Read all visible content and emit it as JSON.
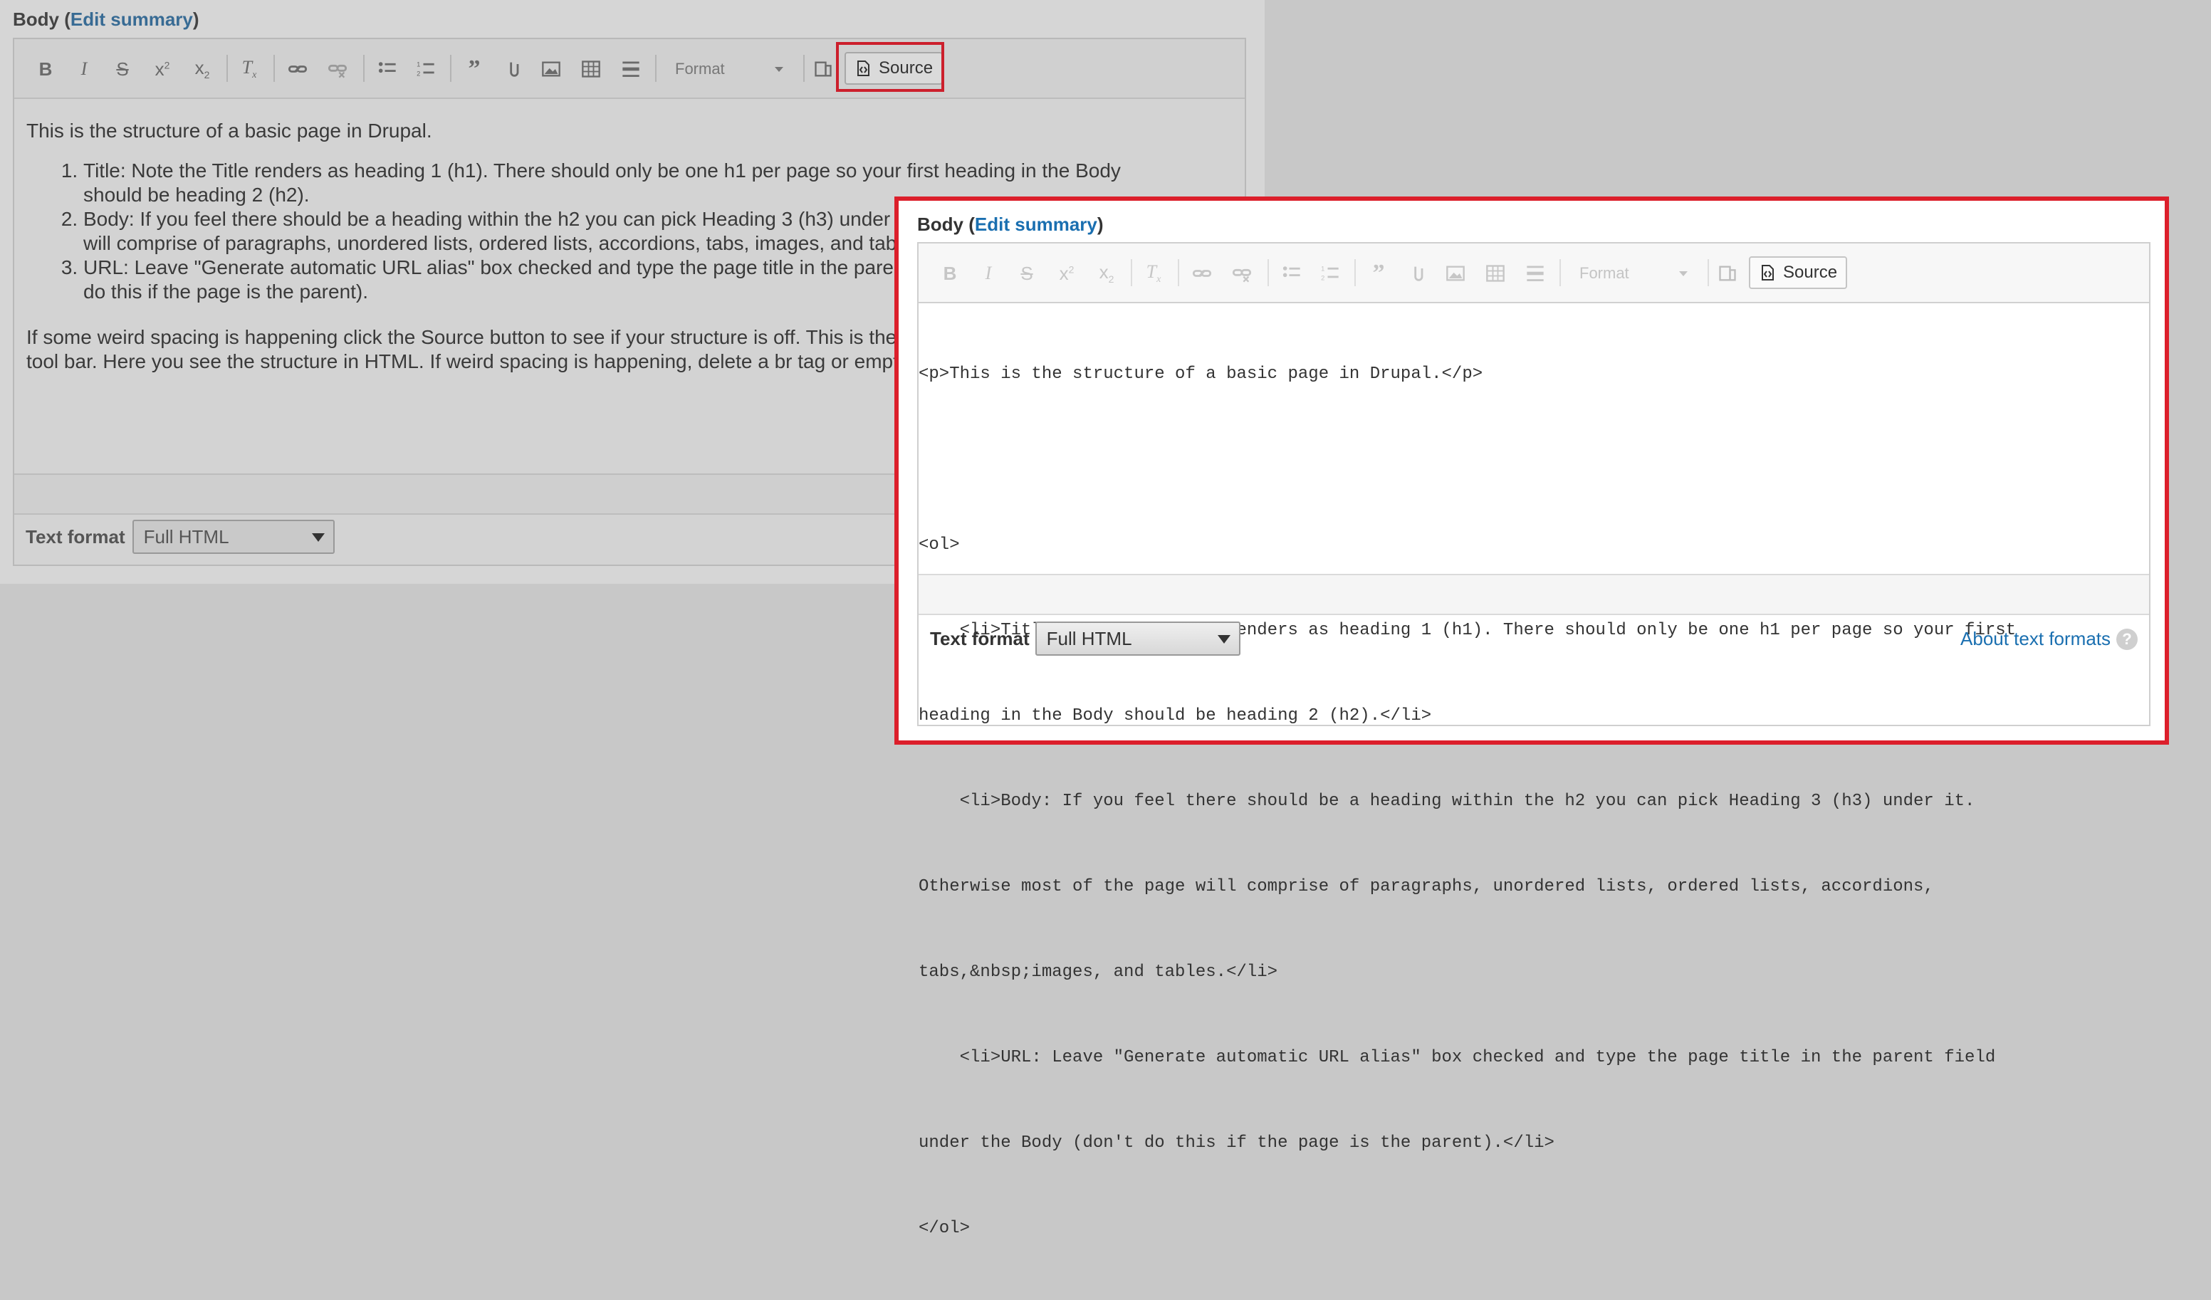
{
  "field": {
    "label": "Body",
    "open_paren": "(",
    "edit_summary": "Edit summary",
    "close_paren": ")"
  },
  "toolbar": {
    "format_label": "Format",
    "source_label": "Source",
    "buttons": [
      "bold-icon",
      "italic-icon",
      "strikethrough-icon",
      "superscript-icon",
      "subscript-icon",
      "remove-format-icon",
      "link-icon",
      "unlink-icon",
      "bulleted-list-icon",
      "numbered-list-icon",
      "blockquote-icon",
      "media-embed-icon",
      "image-icon",
      "table-icon",
      "horizontal-rule-icon",
      "maximize-icon",
      "source-icon"
    ]
  },
  "wysiwyg": {
    "intro": "This is the structure of a basic page in Drupal.",
    "items": [
      "Title: Note the Title renders as heading 1 (h1). There should only be one h1 per page so your first heading in the Body should be heading 2 (h2).",
      "Body: If you feel there should be a heading within the h2 you can pick Heading 3 (h3) under it. Otherwise most of the page will comprise of paragraphs, unordered lists, ordered lists, accordions, tabs, images, and tables.",
      "URL: Leave \"Generate automatic URL alias\" box checked and type the page title in the parent field under the Body (don't do this if the page is the parent)."
    ],
    "outro": "If some weird spacing is happening click the Source button to see if your structure is off. This is the Source button in the editor's tool bar. Here you see the structure in HTML. If weird spacing is happening, delete a br tag or empty paragraphs."
  },
  "source_view": {
    "lines": [
      "<p>This is the structure of a basic page in Drupal.</p>",
      "",
      "<ol>",
      "    <li>Title: Note the Title renders as heading 1 (h1). There should only be one h1 per page so your first",
      "heading in the Body should be heading 2 (h2).</li>",
      "    <li>Body: If you feel there should be a heading within the h2 you can pick Heading 3 (h3) under it.",
      "Otherwise most of the page will comprise of paragraphs, unordered lists, ordered lists, accordions,",
      "tabs,&nbsp;images, and tables.</li>",
      "    <li>URL: Leave \"Generate automatic URL alias\" box checked and type the page title in the parent field",
      "under the Body (don't do this if the page is the parent).</li>",
      "</ol>"
    ]
  },
  "text_format": {
    "label": "Text format",
    "selected": "Full HTML",
    "about_link": "About text formats",
    "help_glyph": "?"
  },
  "colors": {
    "highlight": "#dc1f2b",
    "link": "#1a6fb0"
  }
}
